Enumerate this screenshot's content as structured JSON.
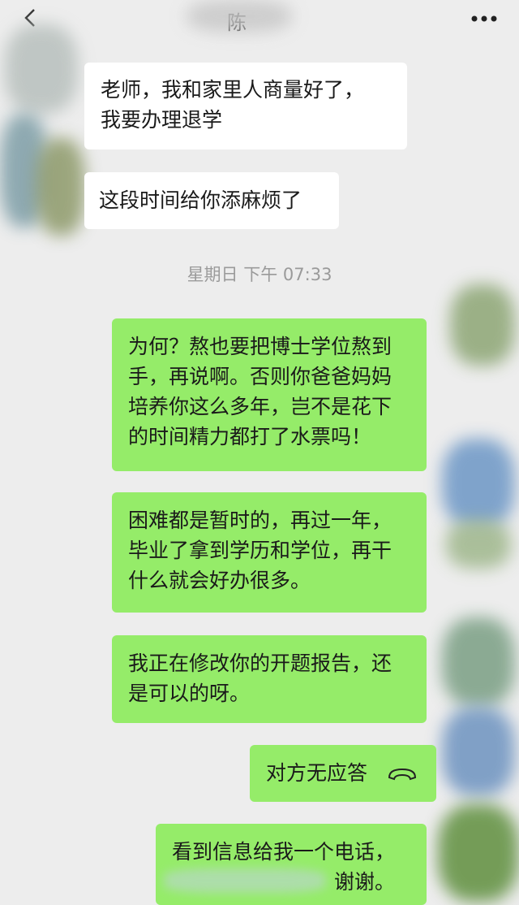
{
  "header": {
    "title": "陈",
    "back_icon": "chevron-left-icon",
    "more_icon": "more-dots-icon"
  },
  "messages": [
    {
      "side": "in",
      "lines": [
        "老师，我和家里人商量好了，",
        "我要办理退学"
      ]
    },
    {
      "side": "in",
      "lines": [
        "这段时间给你添麻烦了"
      ]
    },
    {
      "side": "out",
      "lines": [
        "为何？熬也要把博士学位熬到",
        "手，再说啊。否则你爸爸妈妈",
        "培养你这么多年，岂不是花下",
        "的时间精力都打了水票吗！"
      ]
    },
    {
      "side": "out",
      "lines": [
        "困难都是暂时的，再过一年，",
        "毕业了拿到学历和学位，再干",
        "什么就会好办很多。"
      ]
    },
    {
      "side": "out",
      "lines": [
        "我正在修改你的开题报告，还",
        "是可以的呀。"
      ]
    },
    {
      "side": "out",
      "text": "对方无应答",
      "icon": "call-end-icon"
    },
    {
      "side": "out",
      "lines": [
        "看到信息给我一个电话，",
        "谢谢。"
      ]
    }
  ],
  "timestamp": "星期日 下午 07:33",
  "colors": {
    "background": "#ededed",
    "incoming": "#ffffff",
    "outgoing": "#95ec69"
  }
}
